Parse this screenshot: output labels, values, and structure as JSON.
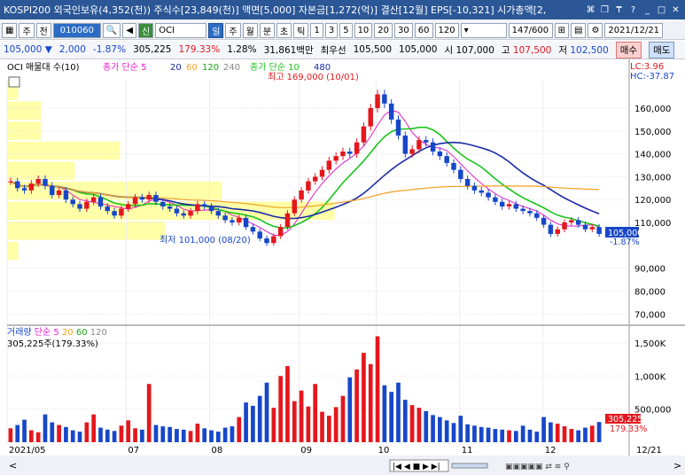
{
  "title": "KOSPI200 외국인보유(4,352(천)) 주식수[23,849(천)] 액면[5,000] 자본금[1,272(억)] 결산[12월] EPS[-10,321] 시가총액[2,",
  "toolbar": {
    "code": "010060",
    "name": "OCI",
    "shin": "신",
    "period_il": "일",
    "period_ju": "주",
    "period_wol": "월",
    "period_bun": "분",
    "period_cho": "초",
    "period_tick": "틱",
    "ju_dropdown": "주",
    "jeon": "전",
    "steps": [
      "1",
      "3",
      "5",
      "10",
      "20",
      "30",
      "60",
      "120"
    ],
    "count": "147/600",
    "date": "2021/12/21"
  },
  "quote": {
    "price": "105,000",
    "arrow": "▼",
    "change": "2,000",
    "pct": "-1.87%",
    "volume": "305,225",
    "vol_pct": "179.33%",
    "turnover": "1.28%",
    "amount": "31,861백만",
    "best_ask_label": "최우선",
    "best_ask": "105,500",
    "best_bid": "105,000",
    "open_label": "시",
    "open": "107,000",
    "high_label": "고",
    "high": "107,500",
    "low_label": "저",
    "low": "102,500",
    "buy": "매수",
    "sell": "매도"
  },
  "legend": {
    "stock": "OCI 매물대 수(10)",
    "ma1_label": "종가 단순 5",
    "ma1_vals": [
      "20",
      "60",
      "120",
      "240"
    ],
    "ma2_label": "종가 단순 10",
    "ma2_val": "480",
    "lc": "LC:3.96",
    "hc": "HC:-37.87"
  },
  "annot": {
    "high": "최고 169,000 (10/01)",
    "low": "최저 101,000 (08/20)"
  },
  "price_axis": [
    "160,000",
    "150,000",
    "140,000",
    "130,000",
    "120,000",
    "110,000",
    "90,000",
    "80,000",
    "70,000"
  ],
  "current": {
    "price": "105,000",
    "pct": "-1.87%"
  },
  "vol_legend": {
    "label": "거래량",
    "ma": "단순 5",
    "vals": [
      "20",
      "60",
      "120"
    ],
    "current": "305,225주(179.33%)"
  },
  "vol_axis": [
    "1,500K",
    "1,000K",
    "500,000"
  ],
  "vol_current": {
    "value": "305,225",
    "pct": "179.33%"
  },
  "x_axis": [
    "2021/05",
    "07",
    "08",
    "09",
    "10",
    "11",
    "12",
    "12/21"
  ],
  "colors": {
    "up": "#e4171d",
    "down": "#1747c9",
    "ma5": "#e01ec8",
    "ma20": "#1a2aa6",
    "ma60": "#f2a020",
    "ma10": "#19c419",
    "vp": "#ffff99"
  },
  "chart_data": {
    "type": "candlestick",
    "note_prices": "approximate daily closes (KRW) 2021/05 - 2021/12/21",
    "closes": [
      128000,
      125000,
      124000,
      127000,
      129000,
      126000,
      122000,
      124000,
      120000,
      118000,
      116000,
      119000,
      121000,
      117000,
      115000,
      113000,
      116000,
      118000,
      121000,
      120000,
      122000,
      119000,
      117000,
      116000,
      114000,
      113000,
      115000,
      118000,
      117000,
      115000,
      113000,
      111000,
      110000,
      112000,
      108000,
      106000,
      103000,
      101000,
      104000,
      108000,
      114000,
      120000,
      124000,
      128000,
      130000,
      133000,
      137000,
      139000,
      141000,
      140000,
      145000,
      152000,
      160000,
      166000,
      162000,
      155000,
      148000,
      140000,
      142000,
      146000,
      145000,
      141000,
      139000,
      136000,
      133000,
      129000,
      126000,
      124000,
      123000,
      121000,
      119000,
      117000,
      118000,
      116000,
      115000,
      114000,
      112000,
      109000,
      105000,
      107000,
      110000,
      111000,
      109000,
      107000,
      108000,
      105000
    ],
    "ylim": [
      67000,
      172000
    ],
    "volume_k": [
      210,
      260,
      340,
      180,
      150,
      420,
      300,
      260,
      230,
      180,
      160,
      300,
      420,
      220,
      190,
      170,
      250,
      330,
      210,
      190,
      880,
      260,
      240,
      230,
      200,
      190,
      170,
      280,
      210,
      180,
      160,
      220,
      240,
      380,
      600,
      550,
      700,
      900,
      520,
      1000,
      1150,
      620,
      780,
      540,
      880,
      460,
      400,
      530,
      700,
      980,
      1100,
      1350,
      1180,
      1600,
      860,
      760,
      900,
      640,
      560,
      520,
      470,
      410,
      380,
      330,
      290,
      400,
      270,
      250,
      230,
      220,
      200,
      190,
      180,
      170,
      250,
      190,
      160,
      380,
      300,
      280,
      240,
      200,
      180,
      220,
      250,
      305
    ],
    "vol_ylim": [
      0,
      1700
    ]
  }
}
